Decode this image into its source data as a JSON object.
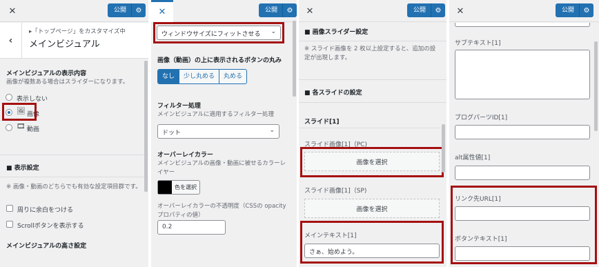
{
  "common": {
    "publish": "公開"
  },
  "p1": {
    "breadcrumb": "▸「トップページ」をカスタマイズ中",
    "title": "メインビジュアル",
    "section_title": "メインビジュアルの表示内容",
    "section_desc": "画像が複数ある場合はスライダーになります。",
    "options": [
      "表示しない",
      "画像",
      "動画"
    ],
    "display_settings": "■ 表示設定",
    "display_desc": "※ 画像・動画のどちらでも有効な設定項目群です。",
    "checks": [
      "周りに余白をつける",
      "Scrollボタンを表示する"
    ],
    "height_title": "メインビジュアルの高さ設定"
  },
  "p2": {
    "select_value": "ウィンドウサイズにフィットさせる",
    "button_round_title": "画像（動画）の上に表示されるボタンの丸み",
    "round_options": [
      "なし",
      "少し丸める",
      "丸める"
    ],
    "filter_title": "フィルター処理",
    "filter_desc": "メインビジュアルに適用するフィルター処理",
    "filter_value": "ドット",
    "overlay_title": "オーバーレイカラー",
    "overlay_desc": "メインビジュアルの画像・動画に被せるカラーレイヤー",
    "color_button": "色を選択",
    "overlay_color": "#000000",
    "opacity_label": "オーバーレイカラーの不透明度（CSSの opacity プロパティの値）",
    "opacity_value": "0.2"
  },
  "p3": {
    "slider_settings": "■ 画像スライダー設定",
    "slider_desc": "※ スライド画像を 2 枚以上設定すると、追加の設定が出現します。",
    "each_slide": "■ 各スライドの設定",
    "slide_title": "スライド[1]",
    "pc_label": "スライド画像[1]（PC)",
    "select_image": "画像を選択",
    "sp_label": "スライド画像[1]（SP)",
    "main_text_label": "メインテキスト[1]",
    "main_text_value": "さぁ、始めよう。"
  },
  "p4": {
    "subtext_label": "サブテキスト[1]",
    "blog_parts_label": "ブログパーツID[1]",
    "alt_label": "alt属性値[1]",
    "link_label": "リンク先URL[1]",
    "button_text_label": "ボタンテキスト[1]"
  }
}
